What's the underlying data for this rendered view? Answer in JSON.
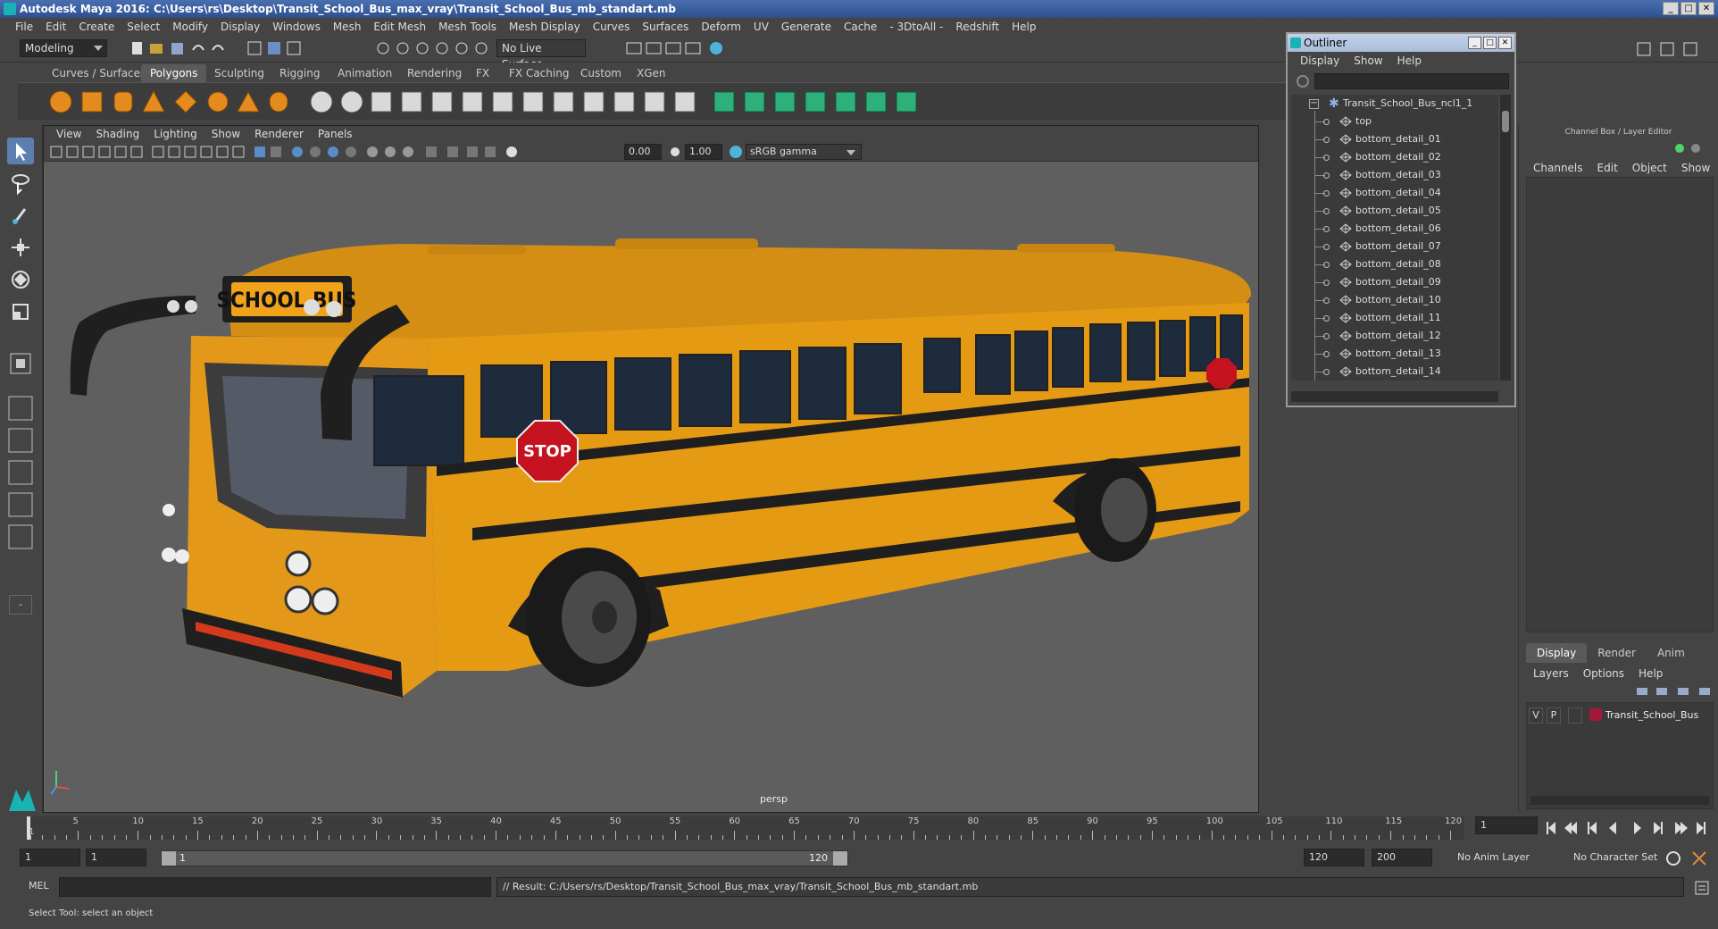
{
  "window": {
    "title": "Autodesk Maya 2016: C:\\Users\\rs\\Desktop\\Transit_School_Bus_max_vray\\Transit_School_Bus_mb_standart.mb",
    "controls": [
      "_",
      "□",
      "✕"
    ]
  },
  "menubar": [
    "File",
    "Edit",
    "Create",
    "Select",
    "Modify",
    "Display",
    "Windows",
    "Mesh",
    "Edit Mesh",
    "Mesh Tools",
    "Mesh Display",
    "Curves",
    "Surfaces",
    "Deform",
    "UV",
    "Generate",
    "Cache",
    "- 3DtoAll -",
    "Redshift",
    "Help"
  ],
  "statusline": {
    "menuset": "Modeling",
    "live_surface": "No Live Surface"
  },
  "shelf": {
    "tabs": [
      "Curves / Surfaces",
      "Polygons",
      "Sculpting",
      "Rigging",
      "Animation",
      "Rendering",
      "FX",
      "FX Caching",
      "Custom",
      "XGen"
    ],
    "active_tab": "Polygons"
  },
  "viewport": {
    "menu": [
      "View",
      "Shading",
      "Lighting",
      "Show",
      "Renderer",
      "Panels"
    ],
    "exposure": "0.00",
    "gamma": "1.00",
    "color_space": "sRGB gamma",
    "camera": "persp",
    "bus_sign": "SCHOOL BUS",
    "stop_sign": "STOP",
    "colors": {
      "bus": "#e59a14",
      "background": "#5f5f5f"
    }
  },
  "outliner": {
    "title": "Outliner",
    "menu": [
      "Display",
      "Show",
      "Help"
    ],
    "root": "Transit_School_Bus_ncl1_1",
    "items": [
      "top",
      "bottom_detail_01",
      "bottom_detail_02",
      "bottom_detail_03",
      "bottom_detail_04",
      "bottom_detail_05",
      "bottom_detail_06",
      "bottom_detail_07",
      "bottom_detail_08",
      "bottom_detail_09",
      "bottom_detail_10",
      "bottom_detail_11",
      "bottom_detail_12",
      "bottom_detail_13",
      "bottom_detail_14"
    ]
  },
  "channelbox": {
    "title": "Channel Box / Layer Editor",
    "menu": [
      "Channels",
      "Edit",
      "Object",
      "Show"
    ],
    "layer_tabs": [
      "Display",
      "Render",
      "Anim"
    ],
    "active_layer_tab": "Display",
    "layer_menu": [
      "Layers",
      "Options",
      "Help"
    ],
    "layer": {
      "v": "V",
      "p": "P",
      "name": "Transit_School_Bus",
      "color": "#a0193a"
    }
  },
  "timeslider": {
    "ticks": [
      "5",
      "10",
      "15",
      "20",
      "25",
      "30",
      "35",
      "40",
      "45",
      "50",
      "55",
      "60",
      "65",
      "70",
      "75",
      "80",
      "85",
      "90",
      "95",
      "100",
      "105",
      "110",
      "115",
      "120"
    ],
    "start_label": "1",
    "current_frame": "1"
  },
  "rangeslider": {
    "start": "1",
    "inner_start": "1",
    "range_start_label": "1",
    "range_end_label": "120",
    "end": "120",
    "total_end": "200",
    "anim_layer": "No Anim Layer",
    "character_set": "No Character Set"
  },
  "cmdline": {
    "mode": "MEL",
    "result": "// Result: C:/Users/rs/Desktop/Transit_School_Bus_max_vray/Transit_School_Bus_mb_standart.mb"
  },
  "helpline": "Select Tool: select an object"
}
